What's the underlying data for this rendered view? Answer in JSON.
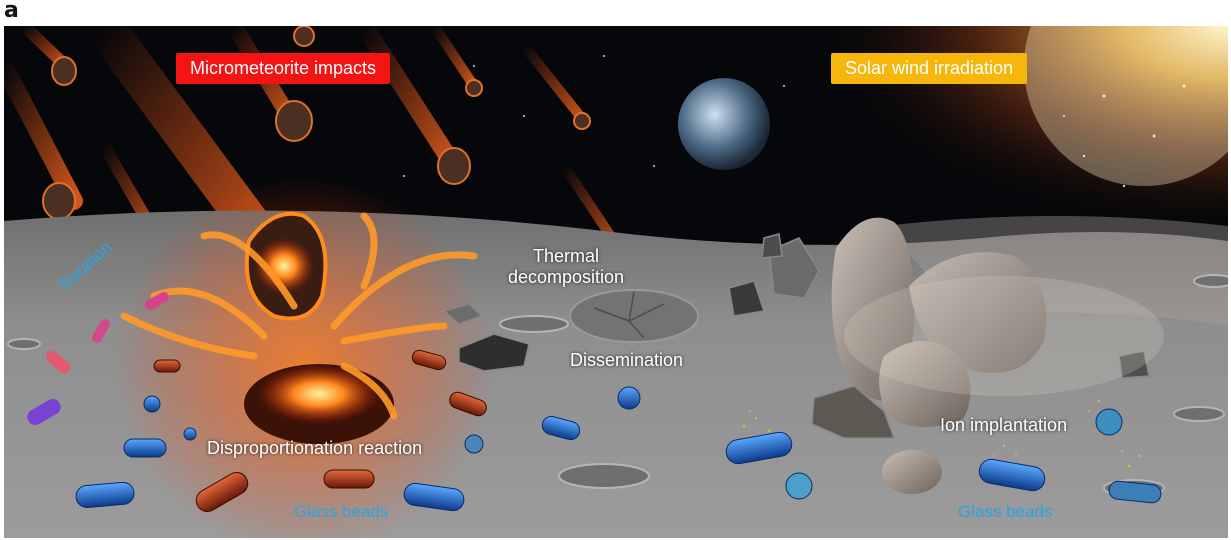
{
  "figure": {
    "panel_letter": "a"
  },
  "labels": {
    "micrometeorite": "Micrometeorite impacts",
    "solar_wind": "Solar wind irradiation",
    "thermal_line1": "Thermal",
    "thermal_line2": "decomposition",
    "dissemination": "Dissemination",
    "rotation": "Rotation",
    "disproportionation": "Disproportionation reaction",
    "glass_beads_left": "Glass beads",
    "ion_implantation": "Ion implantation",
    "glass_beads_right": "Glass beads"
  },
  "colors": {
    "red_badge": "#f51414",
    "yellow_badge": "#f6b60c",
    "cyan_text": "#27a6e3",
    "space": "#050608",
    "ground": "#8d8d8d"
  }
}
